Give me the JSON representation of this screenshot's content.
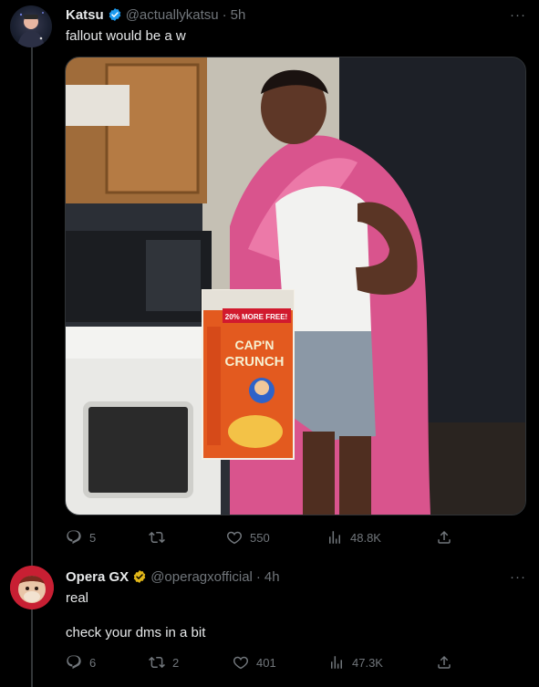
{
  "tweets": [
    {
      "name": "Katsu",
      "handle": "@actuallykatsu",
      "separator": "·",
      "time": "5h",
      "text": "fallout would be a w",
      "verified_color": "#1d9bf0",
      "media_icons": {
        "cereal_box_brand": "CAP'N CRUNCH",
        "cereal_box_banner": "20% MORE FREE!"
      },
      "stats": {
        "replies": "5",
        "reposts": "",
        "likes": "550",
        "views": "48.8K"
      }
    },
    {
      "name": "Opera GX",
      "handle": "@operagxofficial",
      "separator": "·",
      "time": "4h",
      "text_line1": "real",
      "text_line2": "check your dms in a bit",
      "verified_color": "#e2b719",
      "stats": {
        "replies": "6",
        "reposts": "2",
        "likes": "401",
        "views": "47.3K"
      }
    }
  ],
  "more_label": "···",
  "colors": {
    "background": "#000000",
    "text_primary": "#e7e9ea",
    "text_secondary": "#71767b",
    "thread_line": "#333639"
  }
}
